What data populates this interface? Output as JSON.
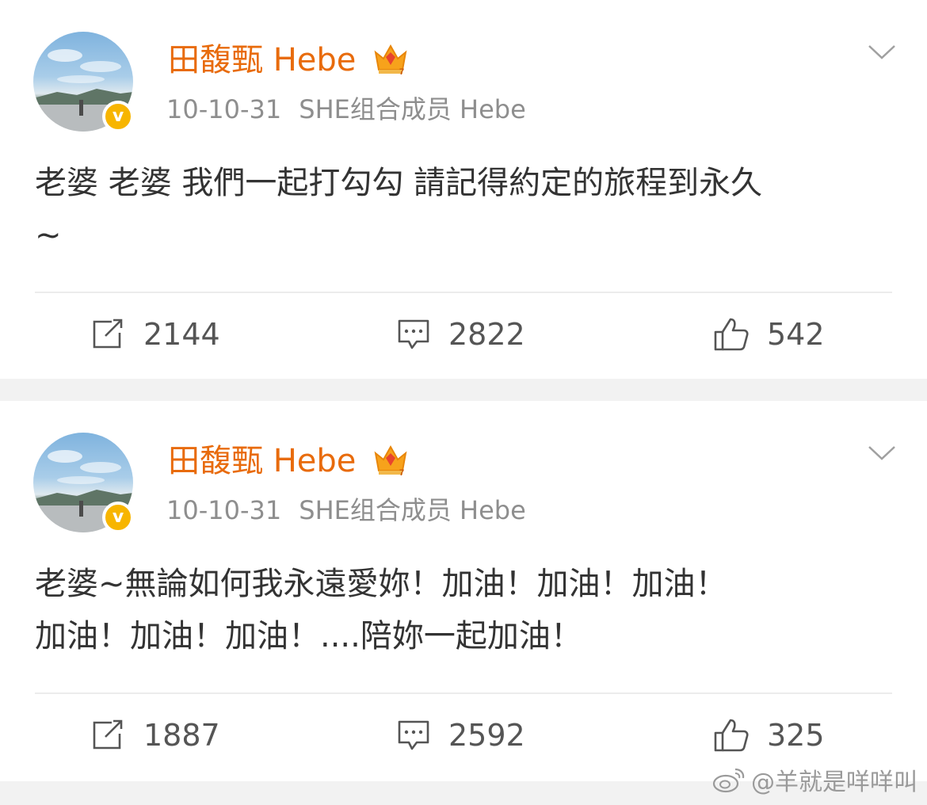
{
  "posts": [
    {
      "username": "田馥甄 Hebe",
      "time": "10-10-31",
      "source": "SHE组合成员 Hebe",
      "content_lines": [
        "老婆 老婆 我們一起打勾勾 請記得約定的旅程到永久",
        "~"
      ],
      "reposts": "2144",
      "comments": "2822",
      "likes": "542"
    },
    {
      "username": "田馥甄 Hebe",
      "time": "10-10-31",
      "source": "SHE组合成员 Hebe",
      "content_lines": [
        "老婆~無論如何我永遠愛妳！加油！加油！加油！",
        "加油！加油！加油！....陪妳一起加油！"
      ],
      "reposts": "1887",
      "comments": "2592",
      "likes": "325"
    }
  ],
  "watermark": "@羊就是咩咩叫",
  "icons": {
    "verified": "verified-v-badge",
    "crown": "vip-crown-icon",
    "more": "chevron-down-icon",
    "repost": "repost-icon",
    "comment": "comment-icon",
    "like": "thumbs-up-icon",
    "weibo": "weibo-logo-icon"
  },
  "colors": {
    "username": "#e86b0c",
    "verified_badge": "#f7b500",
    "meta": "#8e8e8e",
    "separator_band": "#f2f2f2"
  },
  "verified_glyph": "v"
}
